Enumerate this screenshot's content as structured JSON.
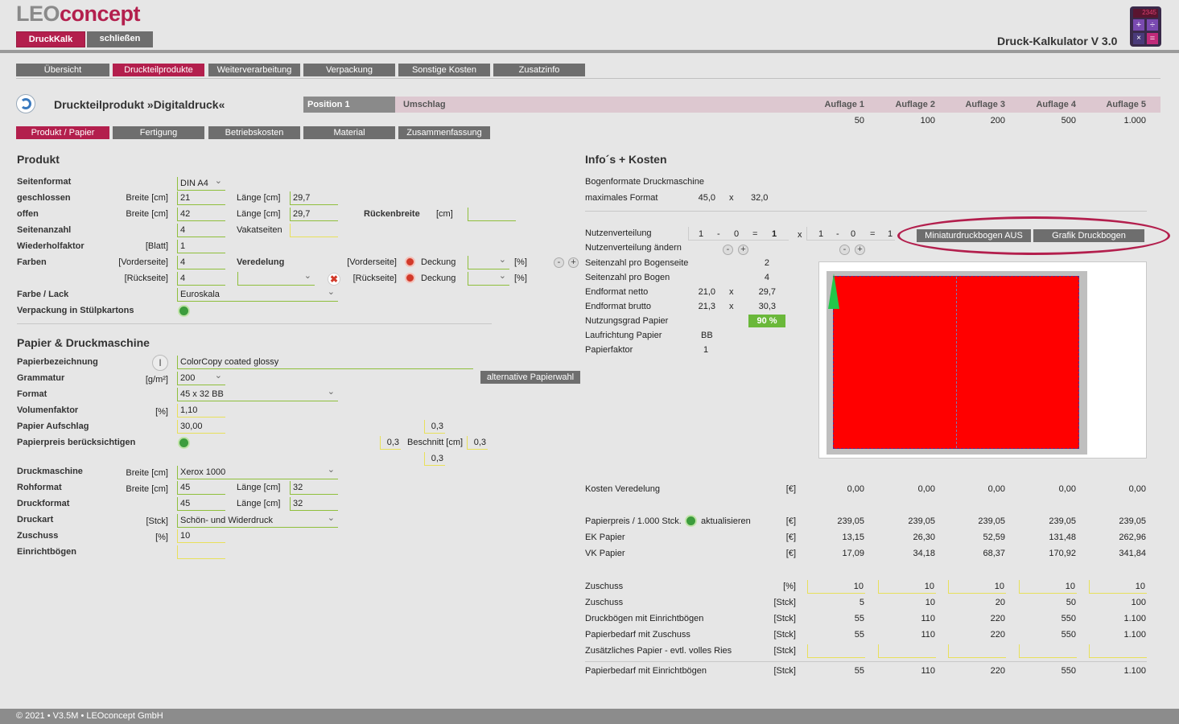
{
  "app": {
    "logo_part1": "LEO",
    "logo_part2": "concept",
    "title": "Druck-Kalkulator V 3.0",
    "btn_druckkalk": "DruckKalk",
    "btn_close": "schließen",
    "footer": "© 2021 • V3.5M • LEOconcept GmbH"
  },
  "colors": {
    "brand": "#b31f4d",
    "tab_gray": "#6e6e6e",
    "green": "#8fbf3c",
    "preview_red": "#ff0000"
  },
  "main_tabs": [
    "Übersicht",
    "Druckteilprodukte",
    "Weiterverarbeitung",
    "Verpackung",
    "Sonstige Kosten",
    "Zusatzinfo"
  ],
  "header": {
    "product_title": "Druckteilprodukt »Digitaldruck«",
    "pos_tab": "Position 1",
    "pos_tab2": "Umschlag",
    "auflagen": [
      "Auflage 1",
      "Auflage 2",
      "Auflage 3",
      "Auflage 4",
      "Auflage 5"
    ],
    "auflage_values": [
      "50",
      "100",
      "200",
      "500",
      "1.000"
    ]
  },
  "sub_tabs": [
    "Produkt / Papier",
    "Fertigung",
    "Betriebskosten",
    "Material",
    "Zusammenfassung"
  ],
  "produkt": {
    "heading": "Produkt",
    "seitenformat_lbl": "Seitenformat",
    "seitenformat_val": "DIN A4",
    "geschlossen_lbl": "geschlossen",
    "offen_lbl": "offen",
    "breite_cm": "Breite [cm]",
    "laenge_cm": "Länge [cm]",
    "geschl_breite": "21",
    "geschl_laenge": "29,7",
    "offen_breite": "42",
    "offen_laenge": "29,7",
    "rueckenbreite_lbl": "Rückenbreite",
    "cm": "[cm]",
    "seitenanzahl_lbl": "Seitenanzahl",
    "seitenanzahl_val": "4",
    "vakatseiten_lbl": "Vakatseiten",
    "wiederhol_lbl": "Wiederholfaktor",
    "blatt": "[Blatt]",
    "wiederhol_val": "1",
    "farben_lbl": "Farben",
    "vorderseite": "[Vorderseite]",
    "rueckseite": "[Rückseite]",
    "farben_vs": "4",
    "farben_rs": "4",
    "veredelung_lbl": "Veredelung",
    "deckung": "Deckung",
    "pct": "[%]",
    "farbe_lack_lbl": "Farbe / Lack",
    "farbe_lack_val": "Euroskala",
    "verpackung_lbl": "Verpackung in Stülpkartons"
  },
  "papier": {
    "heading": "Papier & Druckmaschine",
    "bez_lbl": "Papierbezeichnung",
    "bez_val": "ColorCopy coated glossy",
    "grammatur_lbl": "Grammatur",
    "gm2": "[g/m²]",
    "grammatur_val": "200",
    "alt_btn": "alternative Papierwahl",
    "format_lbl": "Format",
    "format_val": "45 x 32 BB",
    "volumen_lbl": "Volumenfaktor",
    "volumen_val": "1,10",
    "aufschlag_lbl": "Papier Aufschlag",
    "aufschlag_val": "30,00",
    "preis_lbl": "Papierpreis berücksichtigen",
    "beschnitt_lbl": "Beschnitt [cm]",
    "beschnitt_top": "0,3",
    "beschnitt_left": "0,3",
    "beschnitt_right": "0,3",
    "beschnitt_bottom": "0,3",
    "druckmaschine_lbl": "Druckmaschine",
    "druckmaschine_val": "Xerox 1000",
    "rohformat_lbl": "Rohformat",
    "roh_breite": "45",
    "roh_laenge": "32",
    "druckformat_lbl": "Druckformat",
    "druck_breite": "45",
    "druck_laenge": "32",
    "druckart_lbl": "Druckart",
    "stck": "[Stck]",
    "druckart_val": "Schön- und Widerdruck",
    "zuschuss_lbl": "Zuschuss",
    "zuschuss_val": "10",
    "einricht_lbl": "Einrichtbögen"
  },
  "info": {
    "heading": "Info´s + Kosten",
    "bogenformate": "Bogenformate Druckmaschine",
    "max_format": "maximales Format",
    "max_w": "45,0",
    "max_h": "32,0",
    "x": "x",
    "nutzen_lbl": "Nutzenverteilung",
    "nutzen1": [
      "1",
      "-",
      "0",
      "=",
      "1"
    ],
    "nutzen2": [
      "1",
      "-",
      "0",
      "=",
      "1"
    ],
    "nutzen_aendern": "Nutzenverteilung ändern",
    "btn_miniatur": "Miniaturdruckbogen AUS",
    "btn_grafik": "Grafik Druckbogen",
    "rows": [
      {
        "label": "Seitenzahl pro Bogenseite",
        "a": "",
        "b": "2"
      },
      {
        "label": "Seitenzahl pro Bogen",
        "a": "",
        "b": "4"
      },
      {
        "label": "Endformat netto",
        "a": "21,0",
        "b": "29,7"
      },
      {
        "label": "Endformat brutto",
        "a": "21,3",
        "b": "30,3"
      },
      {
        "label": "Nutzungsgrad Papier",
        "a": "",
        "b": "90 %"
      },
      {
        "label": "Laufrichtung Papier",
        "a": "BB",
        "b": ""
      },
      {
        "label": "Papierfaktor",
        "a": "1",
        "b": ""
      }
    ]
  },
  "costs": {
    "euro": "[€]",
    "veredelung": {
      "label": "Kosten Veredelung",
      "values": [
        "0,00",
        "0,00",
        "0,00",
        "0,00",
        "0,00"
      ]
    },
    "papierpreis": {
      "label": "Papierpreis / 1.000 Stck.",
      "aktualisieren": "aktualisieren",
      "values": [
        "239,05",
        "239,05",
        "239,05",
        "239,05",
        "239,05"
      ]
    },
    "ek": {
      "label": "EK Papier",
      "values": [
        "13,15",
        "26,30",
        "52,59",
        "131,48",
        "262,96"
      ]
    },
    "vk": {
      "label": "VK Papier",
      "values": [
        "17,09",
        "34,18",
        "68,37",
        "170,92",
        "341,84"
      ]
    },
    "zuschuss_pct": {
      "label": "Zuschuss",
      "unit": "[%]",
      "values": [
        "10",
        "10",
        "10",
        "10",
        "10"
      ]
    },
    "zuschuss_stck": {
      "label": "Zuschuss",
      "unit": "[Stck]",
      "values": [
        "5",
        "10",
        "20",
        "50",
        "100"
      ]
    },
    "druckboegen": {
      "label": "Druckbögen mit Einrichtbögen",
      "unit": "[Stck]",
      "values": [
        "55",
        "110",
        "220",
        "550",
        "1.100"
      ]
    },
    "bedarf_zuschuss": {
      "label": "Papierbedarf mit Zuschuss",
      "unit": "[Stck]",
      "values": [
        "55",
        "110",
        "220",
        "550",
        "1.100"
      ]
    },
    "zusaetzlich": {
      "label": "Zusätzliches Papier - evtl. volles Ries",
      "unit": "[Stck]"
    },
    "bedarf_einricht": {
      "label": "Papierbedarf mit Einrichtbögen",
      "unit": "[Stck]",
      "values": [
        "55",
        "110",
        "220",
        "550",
        "1.100"
      ]
    }
  }
}
